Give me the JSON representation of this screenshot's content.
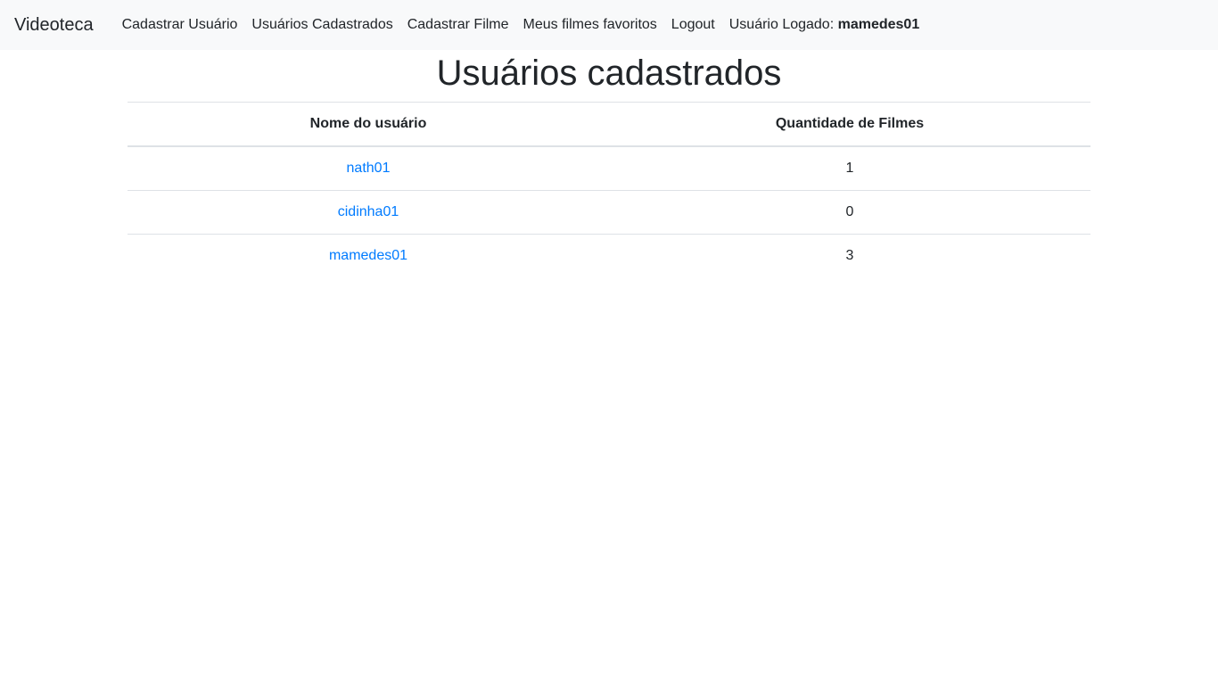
{
  "navbar": {
    "brand": "Videoteca",
    "links": [
      {
        "label": "Cadastrar Usuário"
      },
      {
        "label": "Usuários Cadastrados"
      },
      {
        "label": "Cadastrar Filme"
      },
      {
        "label": "Meus filmes favoritos"
      },
      {
        "label": "Logout"
      }
    ],
    "logged_label": "Usuário Logado: ",
    "logged_user": "mamedes01"
  },
  "page": {
    "title": "Usuários cadastrados"
  },
  "table": {
    "headers": [
      "Nome do usuário",
      "Quantidade de Filmes"
    ],
    "rows": [
      {
        "user": "nath01",
        "count": "1"
      },
      {
        "user": "cidinha01",
        "count": "0"
      },
      {
        "user": "mamedes01",
        "count": "3"
      }
    ]
  },
  "colors": {
    "link": "#007bff",
    "navbar_bg": "#f8f9fa",
    "text": "#212529"
  }
}
